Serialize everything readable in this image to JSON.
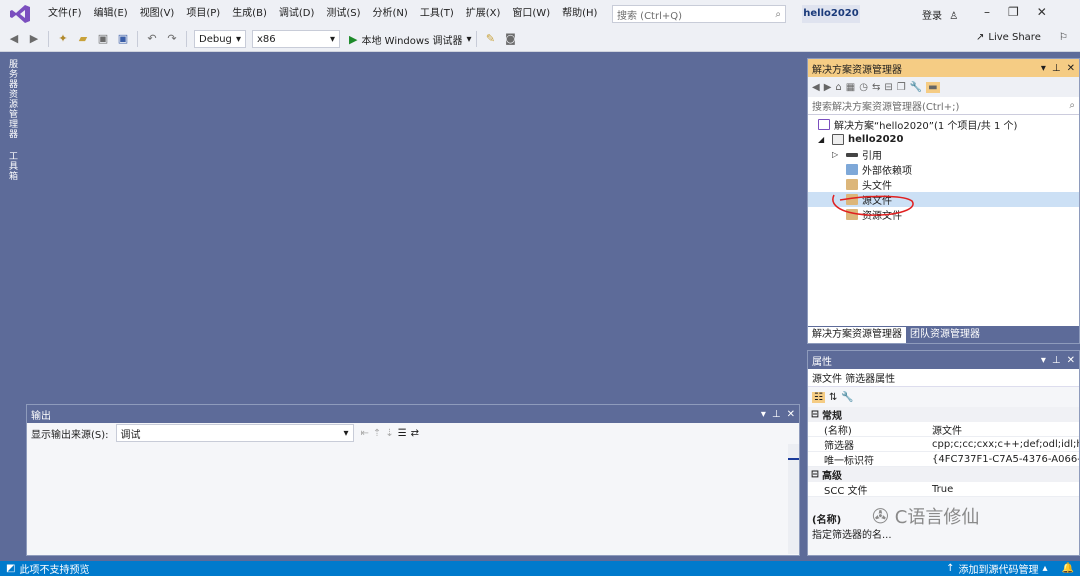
{
  "menu": {
    "items": [
      "文件(F)",
      "编辑(E)",
      "视图(V)",
      "项目(P)",
      "生成(B)",
      "调试(D)",
      "测试(S)",
      "分析(N)",
      "工具(T)",
      "扩展(X)",
      "窗口(W)",
      "帮助(H)"
    ],
    "search_placeholder": "搜索 (Ctrl+Q)",
    "solution_name": "hello2020",
    "login": "登录"
  },
  "toolbar": {
    "config": "Debug",
    "platform": "x86",
    "run_label": "本地 Windows 调试器",
    "live_share": "Live Share"
  },
  "left_strip": {
    "tab1": "服务器资源管理器",
    "tab2": "工具箱"
  },
  "solution_explorer": {
    "title": "解决方案资源管理器",
    "search_placeholder": "搜索解决方案资源管理器(Ctrl+;)",
    "tree": [
      {
        "label": "解决方案“hello2020”(1 个项目/共 1 个)",
        "indent": 0
      },
      {
        "label": "hello2020",
        "indent": 1
      },
      {
        "label": "引用",
        "indent": 2
      },
      {
        "label": "外部依赖项",
        "indent": 2
      },
      {
        "label": "头文件",
        "indent": 2
      },
      {
        "label": "源文件",
        "indent": 2
      },
      {
        "label": "资源文件",
        "indent": 2
      }
    ],
    "bottom_tab_active": "解决方案资源管理器",
    "bottom_tab_other": "团队资源管理器"
  },
  "properties": {
    "title": "属性",
    "object": "源文件  筛选器属性",
    "cat1": "常规",
    "rows1": [
      {
        "name": "(名称)",
        "value": "源文件"
      },
      {
        "name": "筛选器",
        "value": "cpp;c;cc;cxx;c++;def;odl;idl;hp"
      },
      {
        "name": "唯一标识符",
        "value": "{4FC737F1-C7A5-4376-A066-"
      }
    ],
    "cat2": "高级",
    "rows2": [
      {
        "name": "SCC 文件",
        "value": "True"
      }
    ],
    "desc_title": "(名称)",
    "desc_text": "指定筛选器的名..."
  },
  "output": {
    "title": "输出",
    "source_label": "显示输出来源(S):",
    "source_value": "调试"
  },
  "status": {
    "left": "此项不支持预览",
    "right": "添加到源代码管理"
  },
  "watermark": "C语言修仙"
}
